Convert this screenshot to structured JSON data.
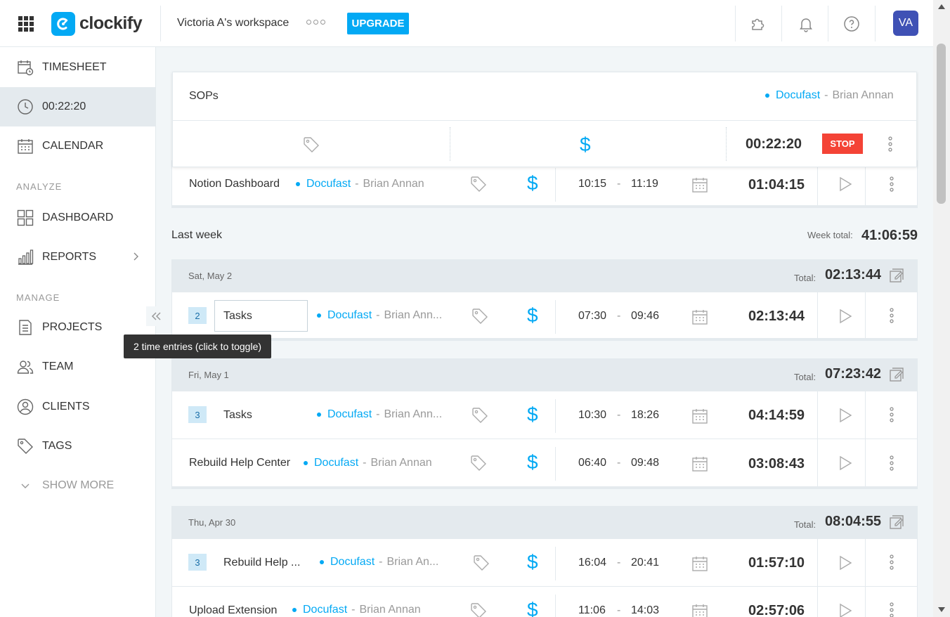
{
  "header": {
    "logo_text": "clockify",
    "workspace": "Victoria A's workspace",
    "upgrade": "UPGRADE",
    "avatar_initials": "VA",
    "icons": [
      "apps-grid-icon",
      "puzzle-icon",
      "bell-icon",
      "help-icon"
    ]
  },
  "sidebar": {
    "items": [
      {
        "label": "TIMESHEET",
        "icon": "timesheet-icon"
      },
      {
        "label": "00:22:20",
        "icon": "clock-icon"
      },
      {
        "label": "CALENDAR",
        "icon": "calendar-icon"
      },
      {
        "label": "DASHBOARD",
        "icon": "dashboard-icon"
      },
      {
        "label": "REPORTS",
        "icon": "reports-icon"
      },
      {
        "label": "PROJECTS",
        "icon": "projects-icon"
      },
      {
        "label": "TEAM",
        "icon": "team-icon"
      },
      {
        "label": "CLIENTS",
        "icon": "clients-icon"
      },
      {
        "label": "TAGS",
        "icon": "tag-icon"
      },
      {
        "label": "SHOW MORE",
        "icon": "chevron-down-icon"
      }
    ],
    "analyze_label": "ANALYZE",
    "manage_label": "MANAGE",
    "tooltip": "2 time entries (click to toggle)"
  },
  "tracker": {
    "description": "SOPs",
    "project": "Docufast",
    "separator": "-",
    "client": "Brian Annan",
    "duration": "00:22:20",
    "stop": "STOP"
  },
  "entries_top": [
    {
      "description": "Notion Dashboard",
      "project": "Docufast",
      "client": "Brian Annan",
      "start": "10:15",
      "end": "11:19",
      "duration": "01:04:15"
    }
  ],
  "week": {
    "label": "Last week",
    "total_label": "Week total:",
    "total": "41:06:59"
  },
  "days": [
    {
      "label": "Sat, May 2",
      "total_label": "Total:",
      "total": "02:13:44",
      "entries": [
        {
          "count": "2",
          "description": "Tasks",
          "project": "Docufast",
          "client": "Brian Ann...",
          "start": "07:30",
          "end": "09:46",
          "duration": "02:13:44"
        }
      ]
    },
    {
      "label": "Fri, May 1",
      "total_label": "Total:",
      "total": "07:23:42",
      "entries": [
        {
          "count": "3",
          "description": "Tasks",
          "project": "Docufast",
          "client": "Brian Ann...",
          "start": "10:30",
          "end": "18:26",
          "duration": "04:14:59"
        },
        {
          "description": "Rebuild Help Center",
          "project": "Docufast",
          "client": "Brian Annan",
          "start": "06:40",
          "end": "09:48",
          "duration": "03:08:43"
        }
      ]
    },
    {
      "label": "Thu, Apr 30",
      "total_label": "Total:",
      "total": "08:04:55",
      "entries": [
        {
          "count": "3",
          "description": "Rebuild Help ...",
          "project": "Docufast",
          "client": "Brian An...",
          "start": "16:04",
          "end": "20:41",
          "duration": "01:57:10"
        },
        {
          "description": "Upload Extension",
          "project": "Docufast",
          "client": "Brian Annan",
          "start": "11:06",
          "end": "14:03",
          "duration": "02:57:06"
        }
      ]
    }
  ],
  "time_separator": "-",
  "colors": {
    "accent": "#03a9f4",
    "stop": "#f44336",
    "avatar": "#3f51b5",
    "sidebar_active": "#e4eaee"
  }
}
